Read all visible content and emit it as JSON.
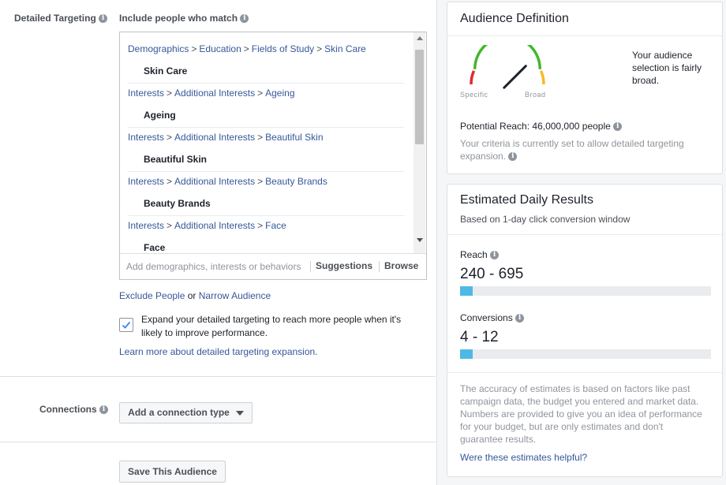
{
  "detailed_targeting": {
    "label": "Detailed Targeting",
    "include_label": "Include people who match",
    "items": [
      {
        "path": [
          "Demographics",
          "Education",
          "Fields of Study",
          "Skin Care"
        ],
        "value": "Skin Care"
      },
      {
        "path": [
          "Interests",
          "Additional Interests",
          "Ageing"
        ],
        "value": "Ageing"
      },
      {
        "path": [
          "Interests",
          "Additional Interests",
          "Beautiful Skin"
        ],
        "value": "Beautiful Skin"
      },
      {
        "path": [
          "Interests",
          "Additional Interests",
          "Beauty Brands"
        ],
        "value": "Beauty Brands"
      },
      {
        "path": [
          "Interests",
          "Additional Interests",
          "Face"
        ],
        "value": "Face"
      }
    ],
    "path_separator": ">",
    "search_placeholder": "Add demographics, interests or behaviors",
    "suggestions_label": "Suggestions",
    "browse_label": "Browse",
    "exclude_label": "Exclude People",
    "or_label": "or",
    "narrow_label": "Narrow Audience",
    "expand_checked": true,
    "expand_text_1": "Expand your detailed targeting to reach more people when it's",
    "expand_text_2": "likely to improve performance.",
    "learn_more": "Learn more about detailed targeting expansion."
  },
  "connections": {
    "label": "Connections",
    "button_label": "Add a connection type"
  },
  "save_button": "Save This Audience",
  "audience_definition": {
    "title": "Audience Definition",
    "gauge_specific": "Specific",
    "gauge_broad": "Broad",
    "gauge_level": 0.75,
    "summary_1": "Your audience",
    "summary_2": "selection is fairly",
    "summary_3": "broad.",
    "potential_reach": "Potential Reach: 46,000,000 people",
    "criteria_1": "Your criteria is currently set to allow detailed targeting",
    "criteria_2": "expansion."
  },
  "estimated_results": {
    "title": "Estimated Daily Results",
    "subtitle": "Based on 1-day click conversion window",
    "reach_label": "Reach",
    "reach_value": "240 - 695",
    "reach_fill": 0.05,
    "conversions_label": "Conversions",
    "conversions_value": "4 - 12",
    "conversions_fill": 0.05,
    "disclaimer": [
      "The accuracy of estimates is based on factors like past",
      "campaign data, the budget you entered and market data.",
      "Numbers are provided to give you an idea of performance",
      "for your budget, but are only estimates and don't",
      "guarantee results."
    ],
    "helpful_link": "Were these estimates helpful?"
  },
  "colors": {
    "link": "#365899",
    "bar_fill": "#4fb9e6",
    "gauge_red": "#e0292f",
    "gauge_green": "#42b72a",
    "gauge_orange": "#f7b928"
  }
}
